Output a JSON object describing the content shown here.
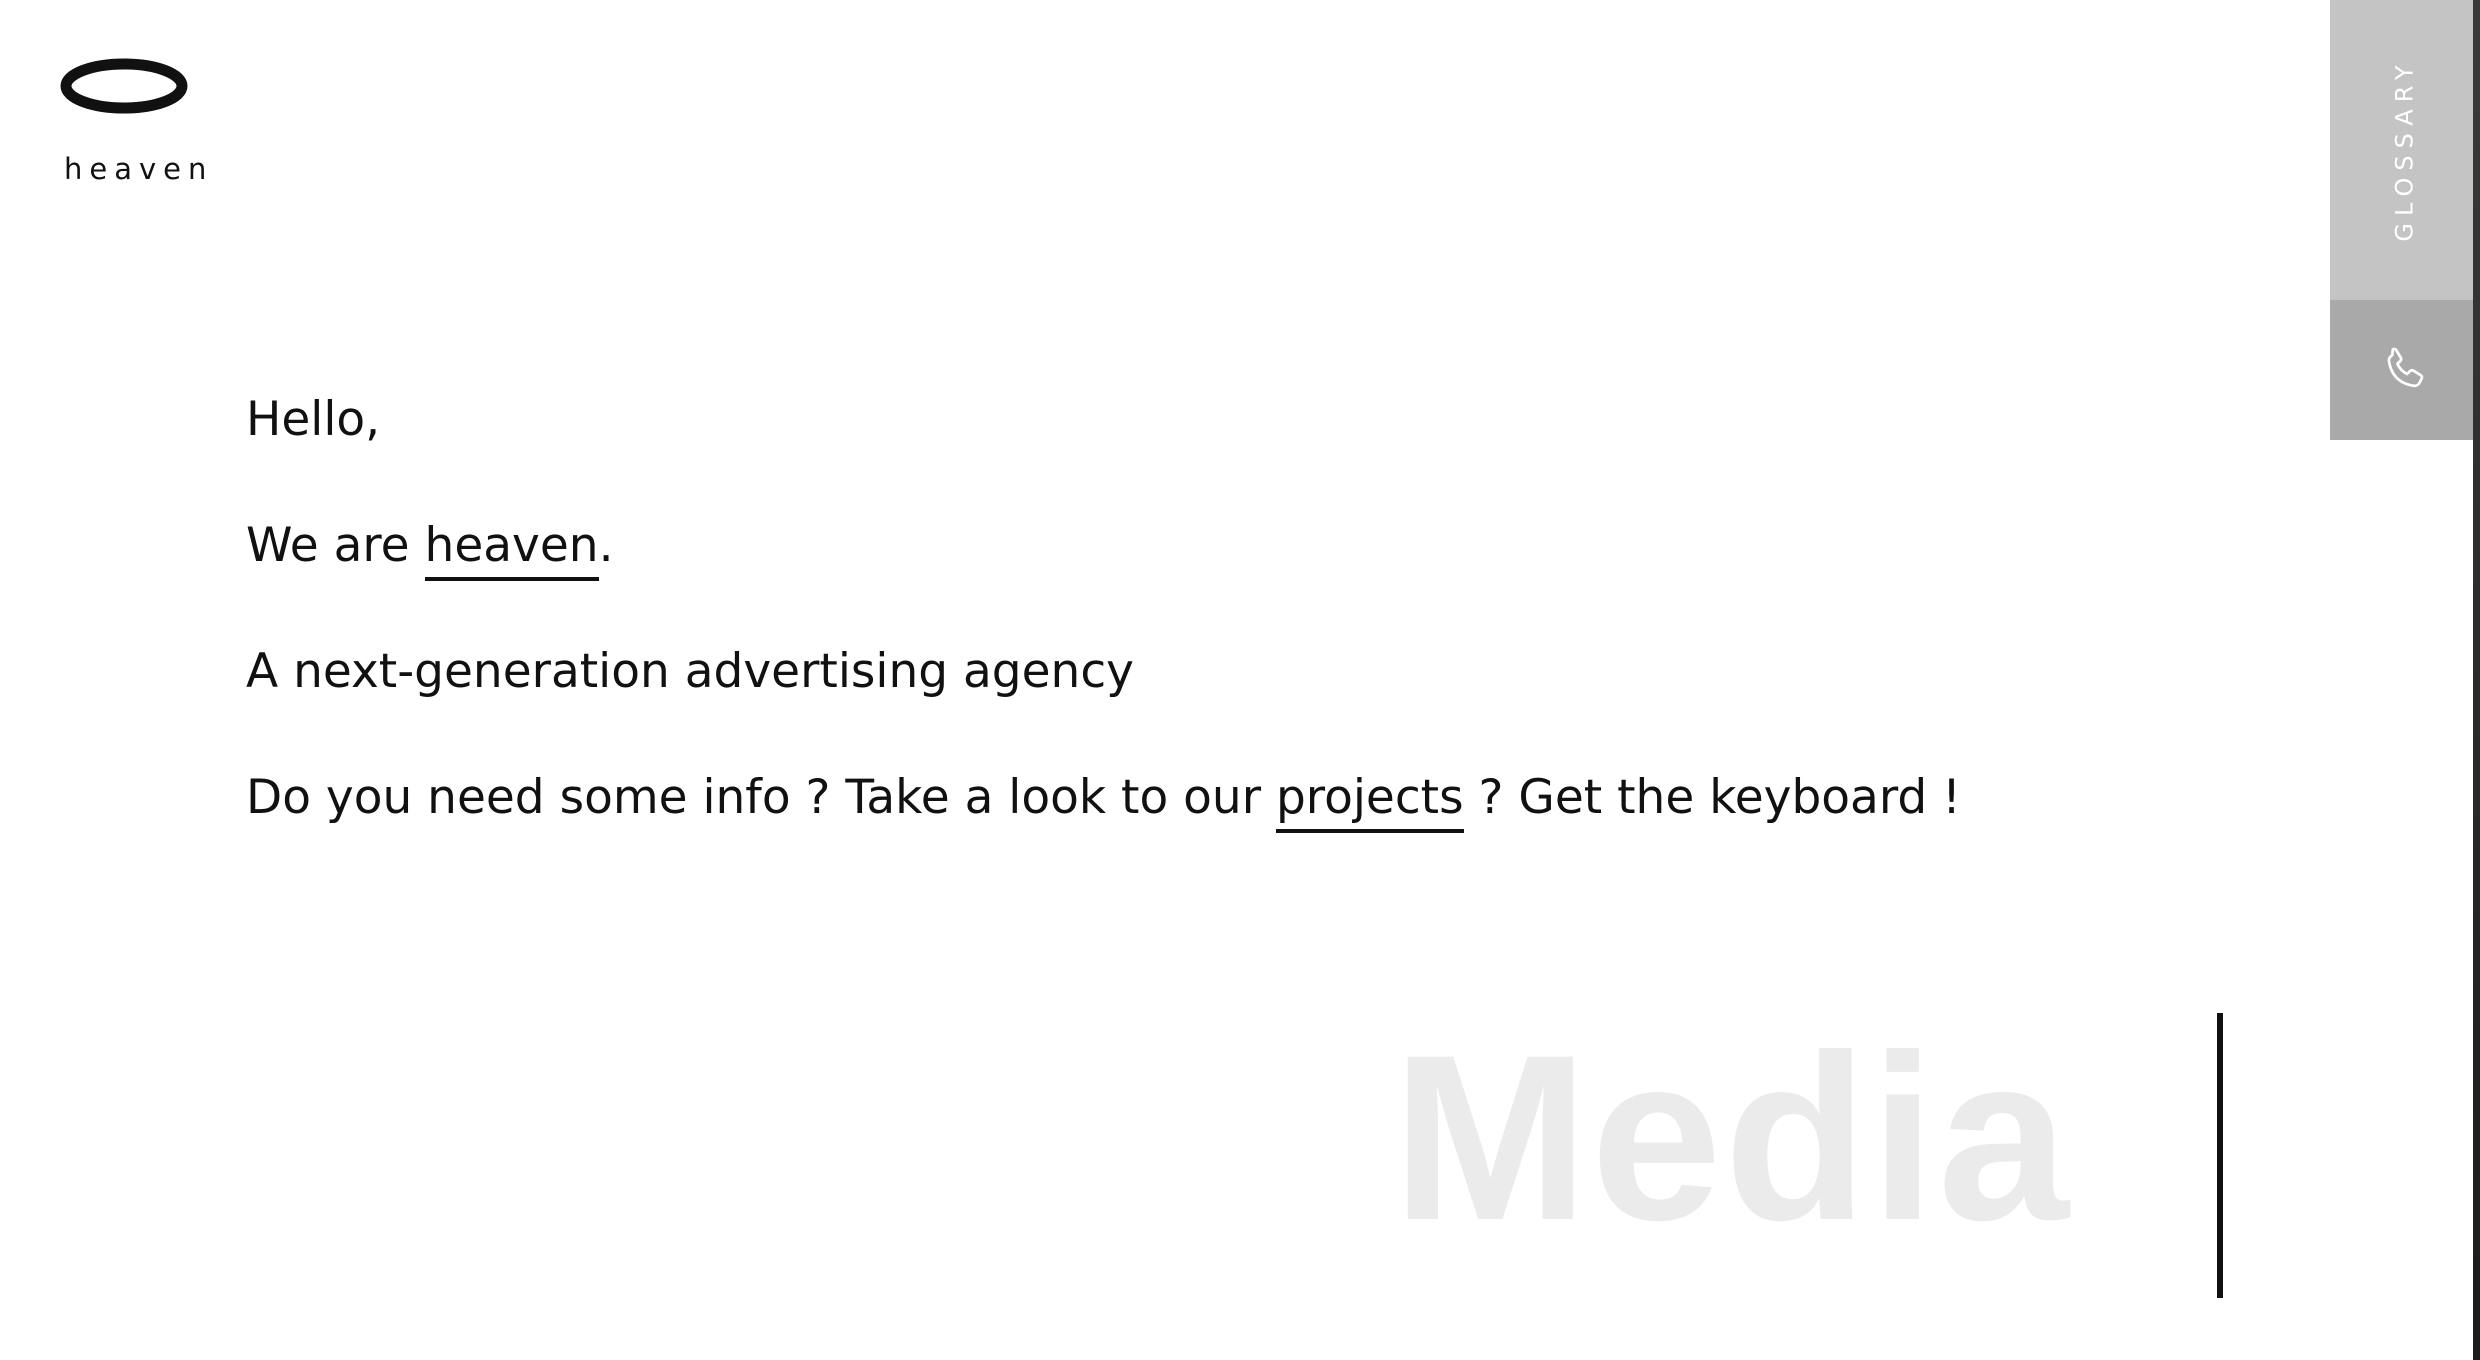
{
  "brand": {
    "logo_icon": "ellipse-ring-logo",
    "name": "heaven"
  },
  "intro": {
    "greeting": "Hello,",
    "we_are_prefix": "We are ",
    "we_are_link": "heaven",
    "we_are_suffix": ".",
    "tagline": "A next-generation advertising agency",
    "info_prefix": "Do you need some info ? Take a look to our ",
    "info_link": "projects",
    "info_suffix": " ? Get the keyboard !"
  },
  "side_nav": {
    "glossary_label": "GLOSSARY",
    "contact_icon": "phone-icon"
  },
  "hero": {
    "rotating_word": "Media"
  },
  "colors": {
    "text": "#111111",
    "background": "#ffffff",
    "glossary_tab": "#c4c4c4",
    "phone_tab": "#a9a9a9",
    "hero_word": "#ebebeb"
  }
}
